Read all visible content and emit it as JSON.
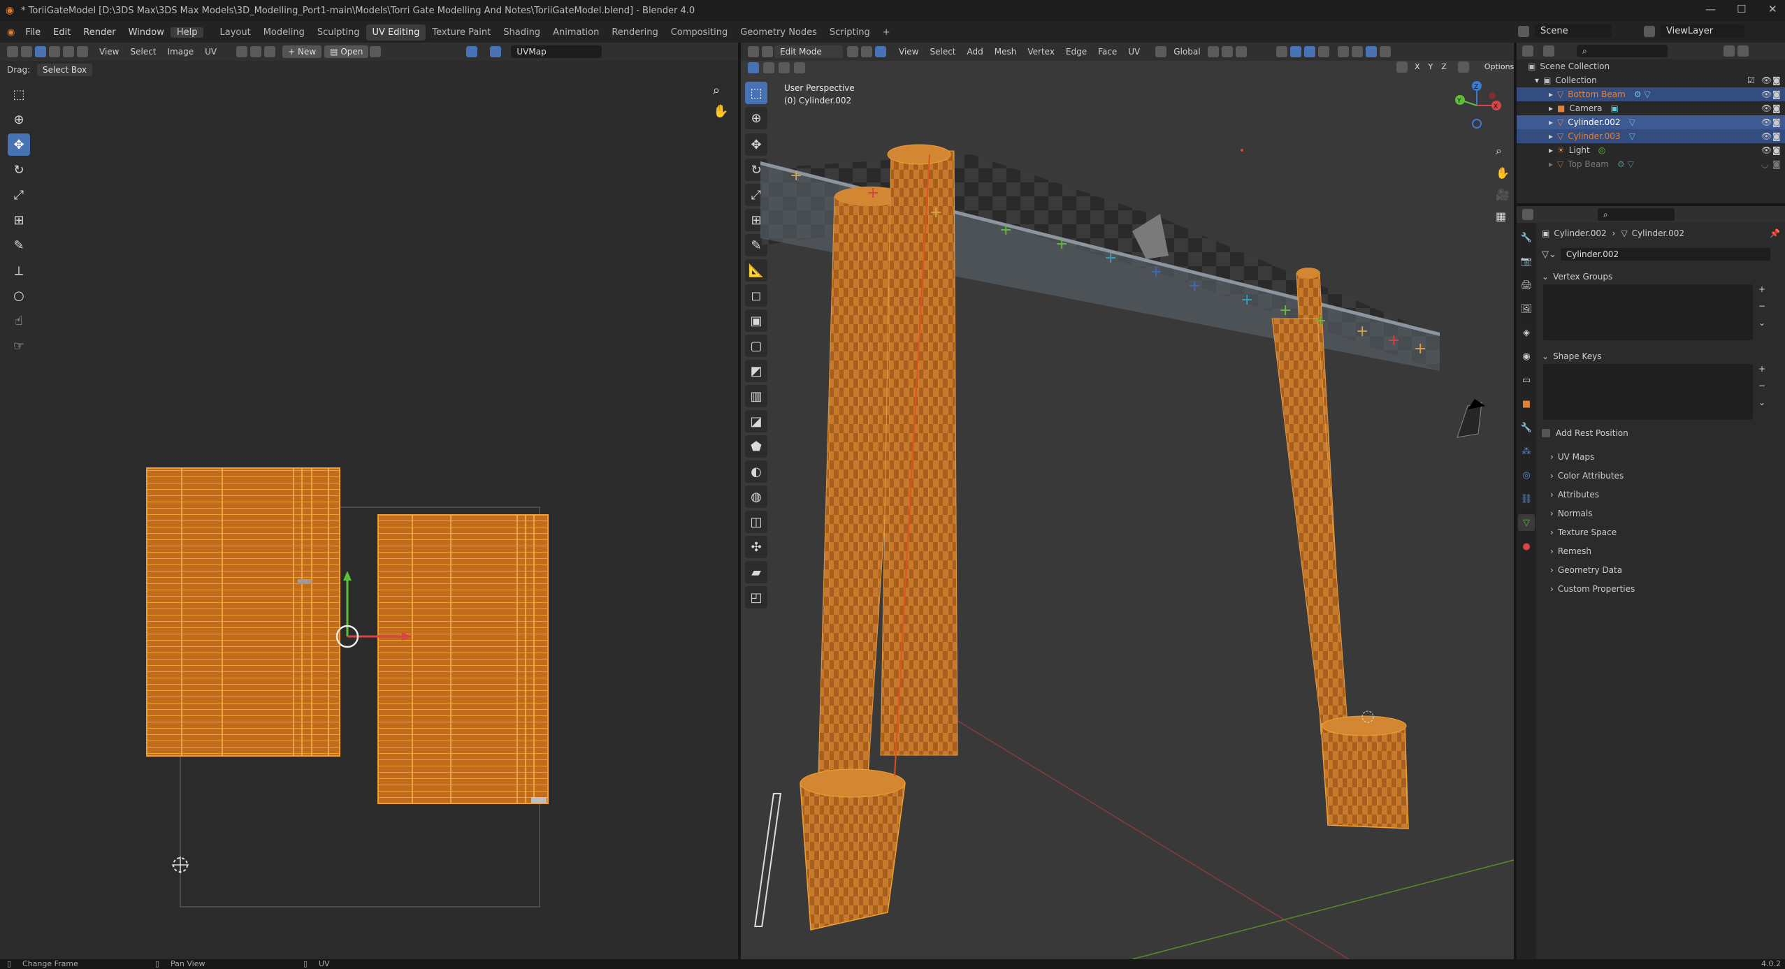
{
  "window": {
    "title": "* ToriiGateModel [D:\\3DS Max\\3DS Max Models\\3D_Modelling_Port1-main\\Models\\Torri Gate Modelling And Notes\\ToriiGateModel.blend] - Blender 4.0"
  },
  "menus": [
    "File",
    "Edit",
    "Render",
    "Window",
    "Help"
  ],
  "workspaces": [
    "Layout",
    "Modeling",
    "Sculpting",
    "UV Editing",
    "Texture Paint",
    "Shading",
    "Animation",
    "Rendering",
    "Compositing",
    "Geometry Nodes",
    "Scripting"
  ],
  "workspace_active": "UV Editing",
  "top_right": {
    "scene_label": "Scene",
    "viewlayer_label": "ViewLayer"
  },
  "uv_editor": {
    "header_items": [
      "View",
      "Select",
      "Image",
      "UV"
    ],
    "new_label": "New",
    "open_label": "Open",
    "uvmap": "UVMap",
    "drag_label": "Drag:",
    "drag_value": "Select Box"
  },
  "viewport": {
    "mode": "Edit Mode",
    "header_items": [
      "View",
      "Select",
      "Add",
      "Mesh",
      "Vertex",
      "Edge",
      "Face",
      "UV"
    ],
    "orientation": "Global",
    "options_label": "Options",
    "overlay_title": "User Perspective",
    "overlay_object": "(0) Cylinder.002",
    "axes": [
      "X",
      "Y",
      "Z"
    ],
    "gizmo_labels": {
      "x": "X",
      "y": "Y",
      "z": "Z"
    }
  },
  "outliner": {
    "root": "Scene Collection",
    "collection": "Collection",
    "items": [
      {
        "name": "Bottom Beam",
        "color": "#e0823a",
        "selected": true
      },
      {
        "name": "Camera",
        "color": "#cccccc",
        "selected": false
      },
      {
        "name": "Cylinder.002",
        "color": "#ffffff",
        "selected": true
      },
      {
        "name": "Cylinder.003",
        "color": "#e0823a",
        "selected": true
      },
      {
        "name": "Light",
        "color": "#cccccc",
        "selected": false
      },
      {
        "name": "Top Beam",
        "color": "#7a7a7a",
        "selected": false
      }
    ]
  },
  "properties": {
    "breadcrumb_obj": "Cylinder.002",
    "breadcrumb_mesh": "Cylinder.002",
    "mesh_name": "Cylinder.002",
    "vertex_groups": "Vertex Groups",
    "shape_keys": "Shape Keys",
    "add_rest_position": "Add Rest Position",
    "sections": [
      "UV Maps",
      "Color Attributes",
      "Attributes",
      "Normals",
      "Texture Space",
      "Remesh",
      "Geometry Data",
      "Custom Properties"
    ]
  },
  "status": {
    "left": "Change Frame",
    "mid": "Pan View",
    "right": "UV",
    "version": "4.0.2"
  },
  "colors": {
    "accent": "#4772b3",
    "uv_fill": "#c9721f",
    "uv_line": "#f0a030",
    "select": "#334d80"
  }
}
